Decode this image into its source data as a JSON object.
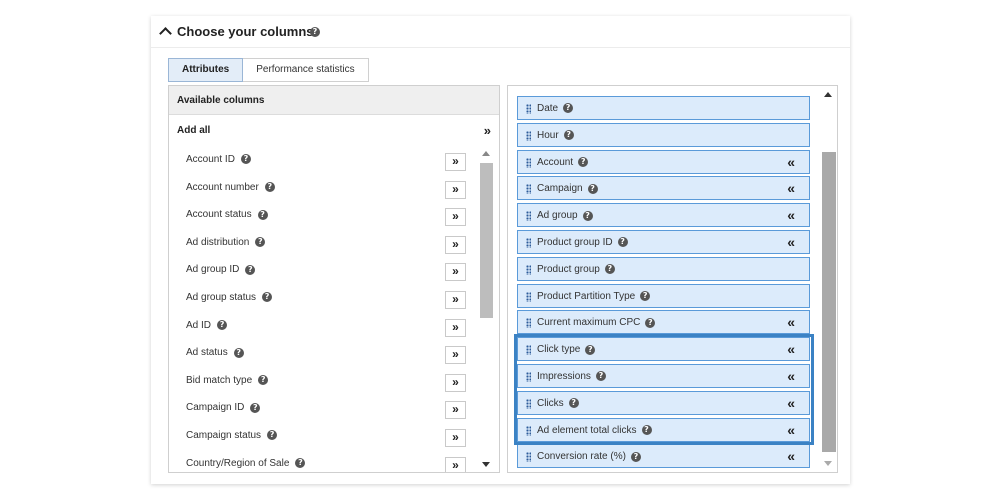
{
  "header": {
    "title": "Choose your columns"
  },
  "tabs": [
    {
      "label": "Attributes",
      "active": true
    },
    {
      "label": "Performance statistics",
      "active": false
    }
  ],
  "available": {
    "heading": "Available columns",
    "add_all_label": "Add all",
    "add_all_icon": "»",
    "add_icon": "»",
    "items": [
      {
        "label": "Account ID"
      },
      {
        "label": "Account number"
      },
      {
        "label": "Account status"
      },
      {
        "label": "Ad distribution"
      },
      {
        "label": "Ad group ID"
      },
      {
        "label": "Ad group status"
      },
      {
        "label": "Ad ID"
      },
      {
        "label": "Ad status"
      },
      {
        "label": "Bid match type"
      },
      {
        "label": "Campaign ID"
      },
      {
        "label": "Campaign status"
      },
      {
        "label": "Country/Region of Sale"
      }
    ]
  },
  "selected": {
    "remove_icon": "«",
    "items": [
      {
        "label": "Date",
        "removable": false
      },
      {
        "label": "Hour",
        "removable": false
      },
      {
        "label": "Account",
        "removable": true
      },
      {
        "label": "Campaign",
        "removable": true
      },
      {
        "label": "Ad group",
        "removable": true
      },
      {
        "label": "Product group ID",
        "removable": true
      },
      {
        "label": "Product group",
        "removable": false
      },
      {
        "label": "Product Partition Type",
        "removable": false
      },
      {
        "label": "Current maximum CPC",
        "removable": true
      },
      {
        "label": "Click type",
        "removable": true
      },
      {
        "label": "Impressions",
        "removable": true
      },
      {
        "label": "Clicks",
        "removable": true
      },
      {
        "label": "Ad element total clicks",
        "removable": true
      },
      {
        "label": "Conversion rate (%)",
        "removable": true
      }
    ]
  },
  "help_glyph": "?",
  "colors": {
    "accent": "#3b82c4",
    "selected_bg": "#dcebfb",
    "selected_border": "#5a9ad9"
  }
}
